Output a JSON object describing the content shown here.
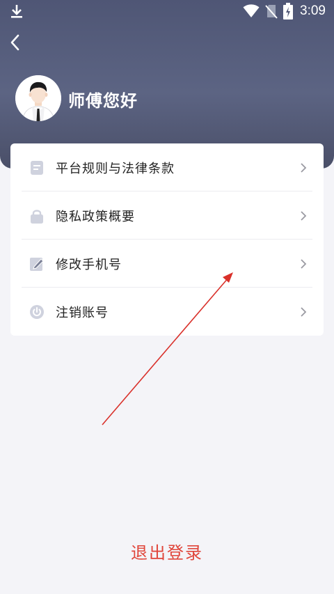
{
  "status_bar": {
    "time": "3:09",
    "icons": [
      "download-icon",
      "wifi-icon",
      "no-sim-icon",
      "battery-charging-icon"
    ]
  },
  "header": {
    "back_icon": "chevron-left-icon",
    "greeting": "师傅您好"
  },
  "menu": {
    "items": [
      {
        "label": "平台规则与法律条款",
        "icon": "document-icon"
      },
      {
        "label": "隐私政策概要",
        "icon": "lock-icon"
      },
      {
        "label": "修改手机号",
        "icon": "edit-icon"
      },
      {
        "label": "注销账号",
        "icon": "power-icon"
      }
    ],
    "chevron_icon": "chevron-right-icon"
  },
  "logout": {
    "label": "退出登录"
  },
  "colors": {
    "header": "#535a78",
    "background": "#f4f4f8",
    "logout_text": "#e0453a",
    "annotation_arrow": "#d9302a",
    "icon": "#cfd2de"
  }
}
